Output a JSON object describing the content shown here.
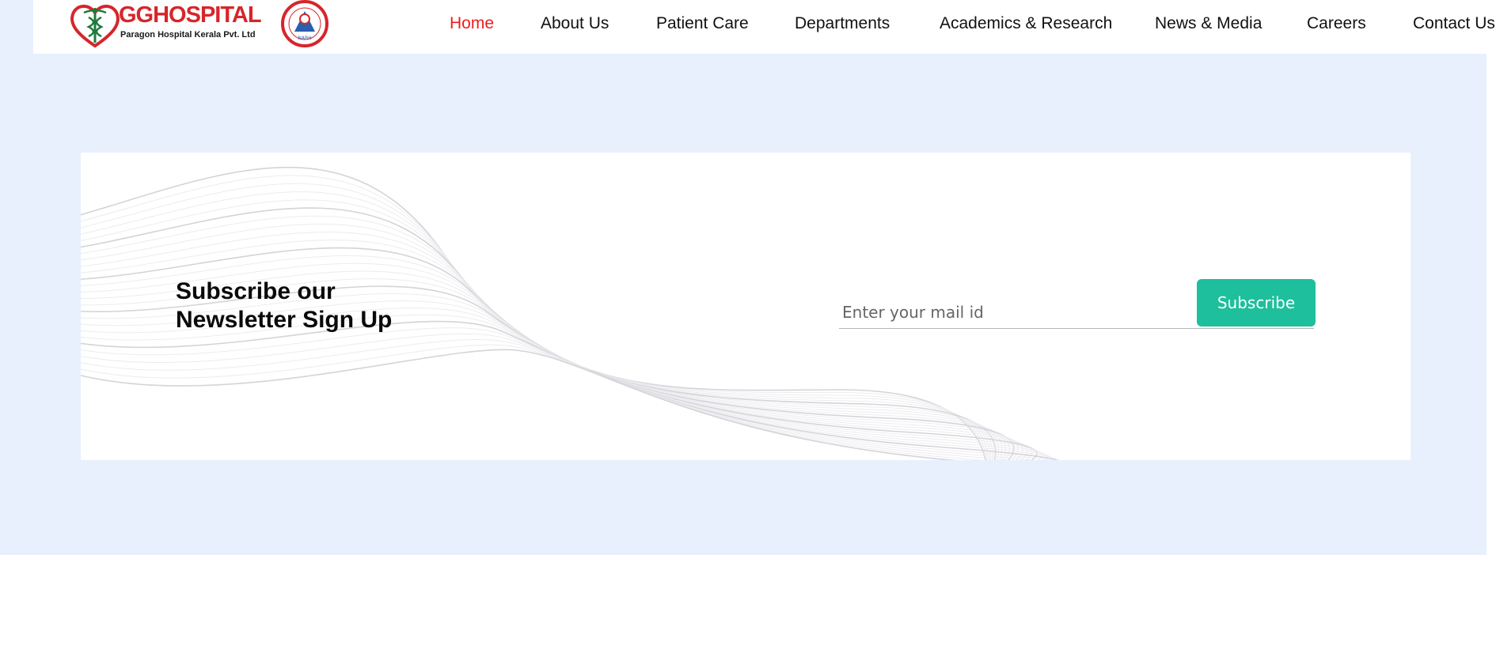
{
  "brand": {
    "title": "GGHOSPITAL",
    "subtitle": "Paragon Hospital Kerala Pvt. Ltd",
    "badge_text": "NABH",
    "primary_color": "#d6262b",
    "logo_icon": "heart-caduceus-icon"
  },
  "nav": {
    "active_color": "#ee1c1c",
    "items": [
      {
        "label": "Home",
        "active": true
      },
      {
        "label": "About Us"
      },
      {
        "label": "Patient Care"
      },
      {
        "label": "Departments"
      },
      {
        "label": "Academics & Research"
      },
      {
        "label": "News & Media"
      },
      {
        "label": "Careers"
      },
      {
        "label": "Contact Us"
      }
    ]
  },
  "newsletter": {
    "title": "Subscribe our\nNewsletter Sign Up",
    "email_placeholder": "Enter your mail id",
    "email_value": "",
    "button_label": "Subscribe",
    "button_color": "#1dbf9c"
  },
  "page": {
    "band_color": "#e8f0fe"
  }
}
